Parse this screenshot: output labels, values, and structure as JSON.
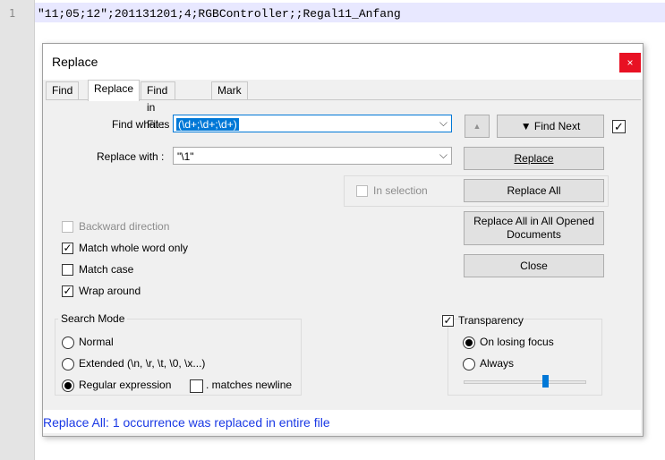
{
  "editor": {
    "line_number": "1",
    "line_text": "\"11;05;12\";201131201;4;RGBController;;Regal11_Anfang"
  },
  "dialog": {
    "title": "Replace",
    "close_glyph": "×",
    "tabs": [
      {
        "label": "Find"
      },
      {
        "label": "Replace"
      },
      {
        "label": "Find in Files"
      },
      {
        "label": "Mark"
      }
    ],
    "find_what": {
      "label": "Find what :",
      "value": "(\\d+;\\d+;\\d+)"
    },
    "replace_with": {
      "label": "Replace with :",
      "value": "\"\\1\""
    },
    "buttons": {
      "up_glyph": "▲",
      "find_next": "▼ Find Next",
      "replace": "Replace",
      "replace_all": "Replace All",
      "replace_all_opened_line1": "Replace All in All Opened",
      "replace_all_opened_line2": "Documents",
      "close": "Close"
    },
    "in_selection": {
      "label": "In selection",
      "checked": false
    },
    "options": {
      "backward_direction": {
        "label": "Backward direction",
        "checked": false
      },
      "match_whole_word": {
        "label": "Match whole word only",
        "checked": true
      },
      "match_case": {
        "label": "Match case",
        "checked": false
      },
      "wrap_around": {
        "label": "Wrap around",
        "checked": true
      }
    },
    "search_mode": {
      "title": "Search Mode",
      "normal": "Normal",
      "extended": "Extended (\\n, \\r, \\t, \\0, \\x...)",
      "regex": "Regular expression",
      "matches_newline": ". matches newline",
      "selected": "regex"
    },
    "transparency": {
      "label": "Transparency",
      "checked": true,
      "on_losing_focus": "On losing focus",
      "always": "Always",
      "selected": "on_losing_focus",
      "level": 0.68
    },
    "status": "Replace All: 1 occurrence was replaced in entire file",
    "check_glyph": "✓"
  }
}
